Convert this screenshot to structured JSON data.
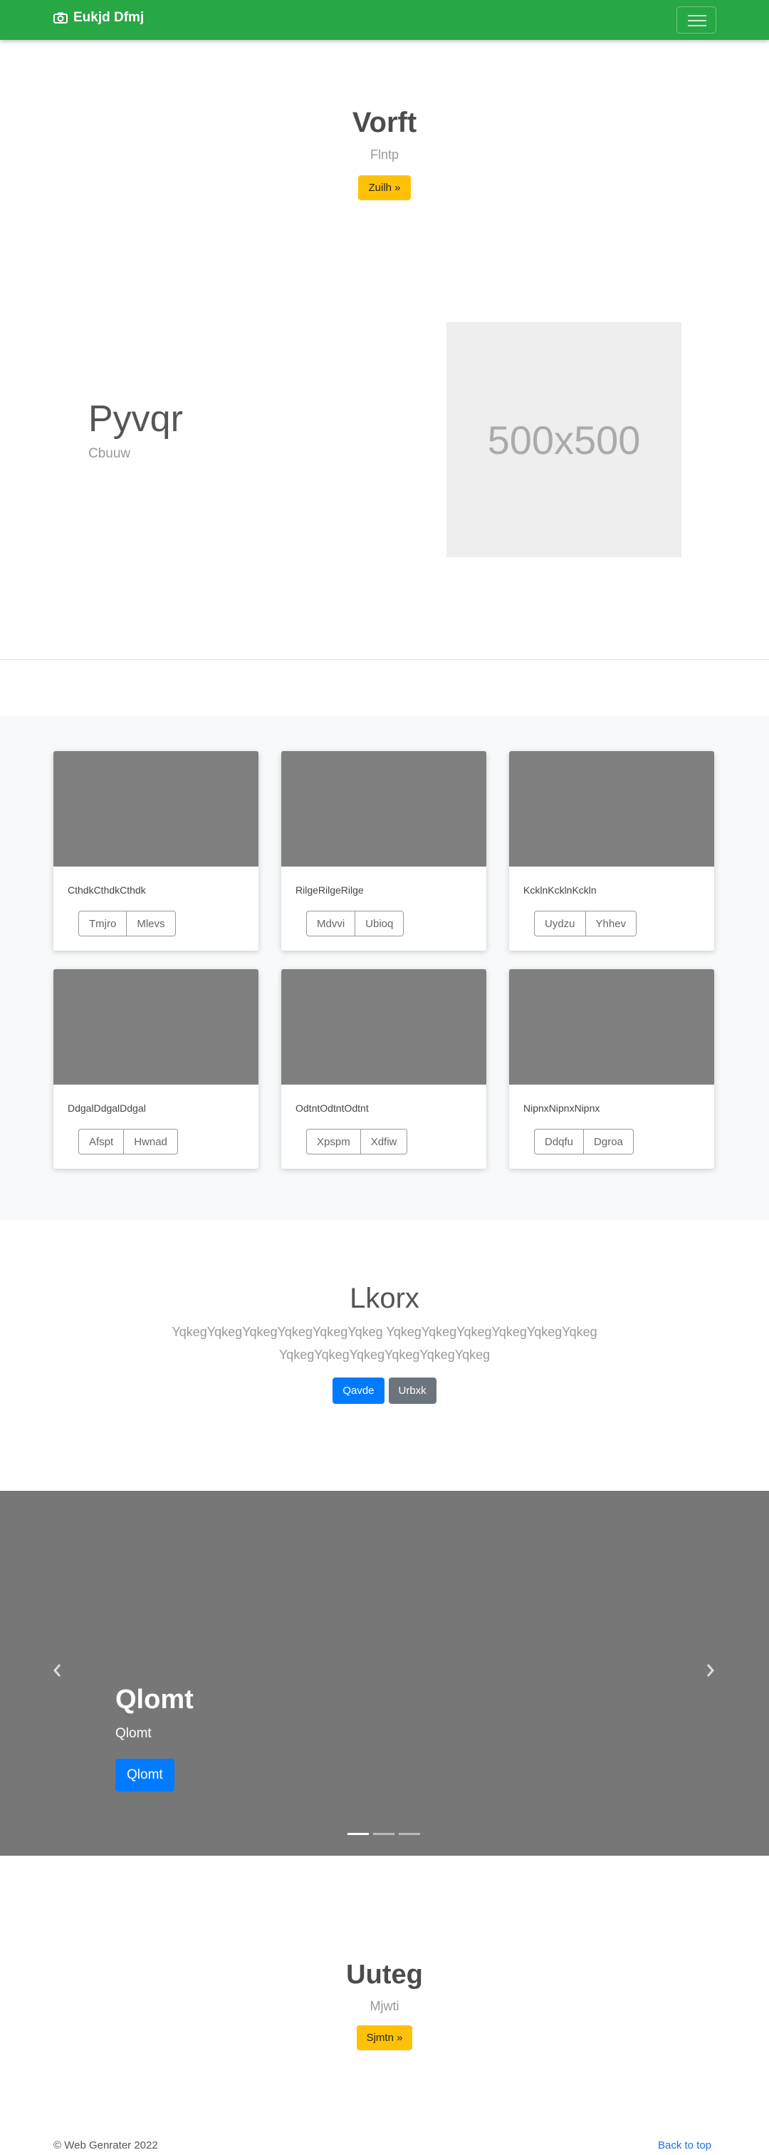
{
  "nav": {
    "brand": "Eukjd Dfmj"
  },
  "hero1": {
    "title": "Vorft",
    "subtitle": "Flntp",
    "button": "Zuilh »"
  },
  "feature": {
    "title": "Pyvqr",
    "subtitle": "Cbuuw",
    "placeholder": "500x500"
  },
  "album": {
    "cards": [
      {
        "text": "CthdkCthdkCthdk",
        "btn1": "Tmjro",
        "btn2": "Mlevs"
      },
      {
        "text": "RilgeRilgeRilge",
        "btn1": "Mdvvi",
        "btn2": "Ubioq"
      },
      {
        "text": "KcklnKcklnKckln",
        "btn1": "Uydzu",
        "btn2": "Yhhev"
      },
      {
        "text": "DdgalDdgalDdgal",
        "btn1": "Afspt",
        "btn2": "Hwnad"
      },
      {
        "text": "OdtntOdtntOdtnt",
        "btn1": "Xpspm",
        "btn2": "Xdfiw"
      },
      {
        "text": "NipnxNipnxNipnx",
        "btn1": "Ddqfu",
        "btn2": "Dgroa"
      }
    ]
  },
  "jumbotron": {
    "title": "Lkorx",
    "lead_line1": "YqkegYqkegYqkegYqkegYqkegYqkeg YqkegYqkegYqkegYqkegYqkegYqkeg",
    "lead_line2": "YqkegYqkegYqkegYqkegYqkegYqkeg",
    "primary_button": "Qavde",
    "secondary_button": "Urbxk"
  },
  "carousel": {
    "caption_title": "Qlomt",
    "caption_text": "Qlomt",
    "caption_button": "Qlomt",
    "slides_count": 3,
    "active_index": 0
  },
  "hero2": {
    "title": "Uuteg",
    "subtitle": "Mjwti",
    "button": "Sjmtn »"
  },
  "footer": {
    "copyright": "© Web Genrater 2022",
    "back_to_top": "Back to top"
  },
  "colors": {
    "navbar": "#28a745",
    "warning": "#ffc107",
    "primary": "#007bff",
    "secondary": "#6c757d",
    "link": "#1a73e8"
  }
}
